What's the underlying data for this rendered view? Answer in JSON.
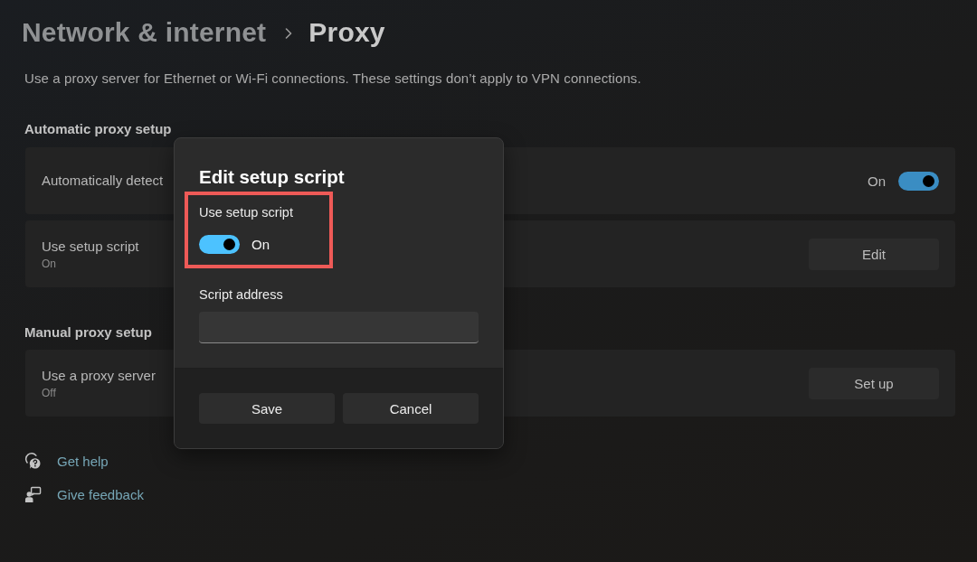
{
  "header": {
    "breadcrumb": [
      {
        "label": "Network & internet",
        "current": false
      },
      {
        "label": "Proxy",
        "current": true
      }
    ]
  },
  "description": "Use a proxy server for Ethernet or Wi-Fi connections. These settings don’t apply to VPN connections.",
  "sections": [
    {
      "title": "Automatic proxy setup",
      "rows": [
        {
          "kind": "toggle",
          "label": "Automatically detect",
          "state_text": "On",
          "on": true
        },
        {
          "kind": "button",
          "label": "Use setup script",
          "sublabel": "On",
          "button": "Edit"
        }
      ]
    },
    {
      "title": "Manual proxy setup",
      "rows": [
        {
          "kind": "button",
          "label": "Use a proxy server",
          "sublabel": "Off",
          "button": "Set up"
        }
      ]
    }
  ],
  "links": [
    {
      "kind": "help",
      "label": "Get help"
    },
    {
      "kind": "feedback",
      "label": "Give feedback"
    }
  ],
  "dialog": {
    "title": "Edit setup script",
    "toggle": {
      "label": "Use setup script",
      "state_text": "On",
      "on": true,
      "highlighted": true
    },
    "field": {
      "label": "Script address"
    },
    "buttons": [
      "Save",
      "Cancel"
    ]
  }
}
